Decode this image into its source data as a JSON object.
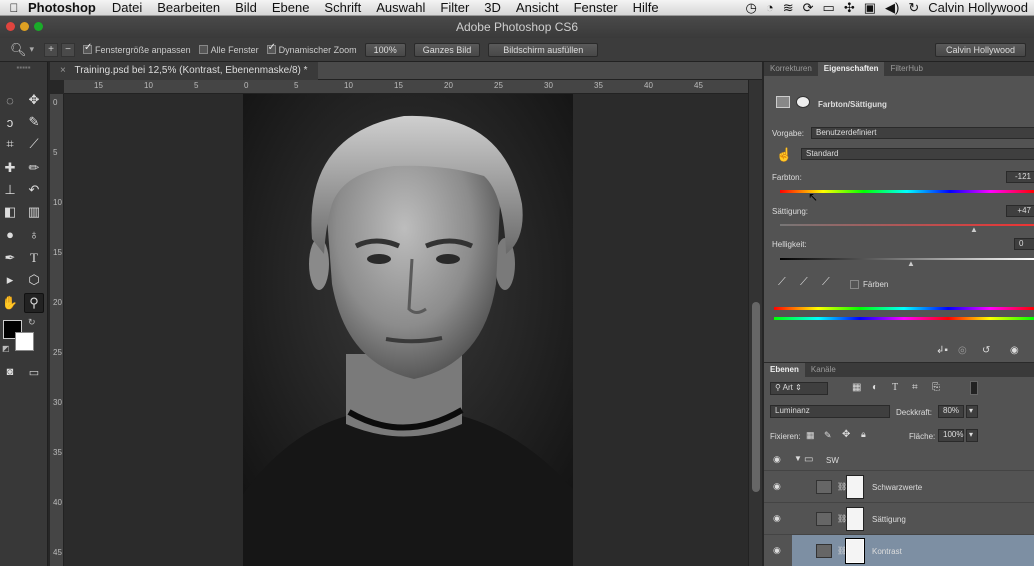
{
  "menubar": {
    "app": "Photoshop",
    "items": [
      "Datei",
      "Bearbeiten",
      "Bild",
      "Ebene",
      "Schrift",
      "Auswahl",
      "Filter",
      "3D",
      "Ansicht",
      "Fenster",
      "Hilfe"
    ],
    "user": "Calvin Hollywood"
  },
  "window": {
    "title": "Adobe Photoshop CS6"
  },
  "options": {
    "fit_windows": "Fenstergröße anpassen",
    "all_windows": "Alle Fenster",
    "scrubby_zoom": "Dynamischer Zoom",
    "zoom_100": "100%",
    "fit_screen": "Ganzes Bild",
    "fill_screen": "Bildschirm ausfüllen",
    "workspace": "Calvin Hollywood"
  },
  "document": {
    "tab_title": "Training.psd bei 12,5% (Kontrast, Ebenenmaske/8) *",
    "ruler_h": [
      "15",
      "10",
      "5",
      "0",
      "5",
      "10",
      "15",
      "20",
      "25",
      "30",
      "35",
      "40",
      "45"
    ],
    "ruler_v": [
      "0",
      "5",
      "10",
      "15",
      "20",
      "25",
      "30",
      "35",
      "40",
      "45"
    ]
  },
  "properties": {
    "tabs": [
      "Korrekturen",
      "Eigenschaften",
      "FilterHub"
    ],
    "active_tab": "Eigenschaften",
    "title": "Farbton/Sättigung",
    "preset_label": "Vorgabe:",
    "preset_value": "Benutzerdefiniert",
    "channel_value": "Standard",
    "hue_label": "Farbton:",
    "hue_value": "-121",
    "sat_label": "Sättigung:",
    "sat_value": "+47",
    "light_label": "Helligkeit:",
    "light_value": "0",
    "colorize_label": "Färben"
  },
  "layers": {
    "tabs": [
      "Ebenen",
      "Kanäle"
    ],
    "active_tab": "Ebenen",
    "filter_kind": "Art",
    "blend_mode": "Luminanz",
    "opacity_label": "Deckkraft:",
    "opacity_value": "80%",
    "lock_label": "Fixieren:",
    "fill_label": "Fläche:",
    "fill_value": "100%",
    "group_name": "SW",
    "items": [
      {
        "name": "Schwarzwerte"
      },
      {
        "name": "Sättigung"
      },
      {
        "name": "Kontrast"
      }
    ]
  }
}
